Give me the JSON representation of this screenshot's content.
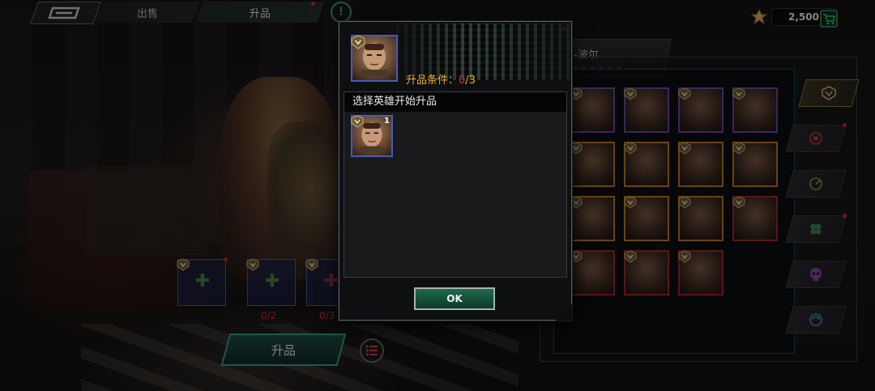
{
  "header": {
    "tabs": [
      {
        "label": "出售"
      },
      {
        "label": "升品"
      }
    ],
    "currency_amount": "2,500"
  },
  "hero": {
    "name": "-波尔"
  },
  "materials": {
    "slots": [
      {
        "count": ""
      },
      {
        "count": "0/2"
      },
      {
        "count": "0/3"
      }
    ]
  },
  "actions": {
    "upgrade_label": "升品"
  },
  "modal": {
    "cond_label": "升品条件：",
    "cond_current": "0",
    "cond_sep": "/",
    "cond_required": "3",
    "list_title": "选择英雄开始升品",
    "candidate_qty": "1",
    "ok_label": "OK"
  },
  "colors": {
    "accent_green": "#3aa06a",
    "condition_gold": "#e6b030",
    "condition_red": "#d03030",
    "frame_blue": "#4a5ab8"
  },
  "icons": [
    "back-icon",
    "info-icon",
    "gem-icon",
    "cart-icon",
    "rank-badge-icon",
    "list-icon",
    "plus-icon"
  ]
}
